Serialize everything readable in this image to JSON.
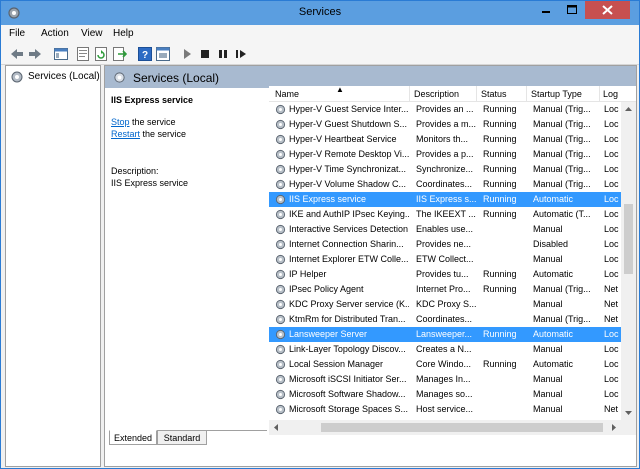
{
  "window": {
    "title": "Services"
  },
  "menu": [
    "File",
    "Action",
    "View",
    "Help"
  ],
  "toolbar": {
    "icons": [
      "back-arrow-icon",
      "forward-arrow-icon",
      "console-tree-icon",
      "refresh-icon",
      "export-list-icon",
      "help-icon",
      "properties-icon",
      "start-service-icon",
      "stop-service-icon",
      "pause-service-icon",
      "restart-service-icon"
    ]
  },
  "tree": {
    "label": "Services (Local)"
  },
  "pane": {
    "header_title": "Services (Local)",
    "selected_name": "IIS Express service",
    "stop_link": "Stop",
    "stop_rest": " the service",
    "restart_link": "Restart",
    "restart_rest": " the service",
    "desc_label": "Description:",
    "desc_text": "IIS Express service"
  },
  "columns": [
    "Name",
    "Description",
    "Status",
    "Startup Type",
    "Log"
  ],
  "rows": [
    {
      "name": "Hyper-V Guest Service Inter...",
      "desc": "Provides an ...",
      "status": "Running",
      "startup": "Manual (Trig...",
      "log": "Loc",
      "selected": false
    },
    {
      "name": "Hyper-V Guest Shutdown S...",
      "desc": "Provides a m...",
      "status": "Running",
      "startup": "Manual (Trig...",
      "log": "Loc",
      "selected": false
    },
    {
      "name": "Hyper-V Heartbeat Service",
      "desc": "Monitors th...",
      "status": "Running",
      "startup": "Manual (Trig...",
      "log": "Loc",
      "selected": false
    },
    {
      "name": "Hyper-V Remote Desktop Vi...",
      "desc": "Provides a p...",
      "status": "Running",
      "startup": "Manual (Trig...",
      "log": "Loc",
      "selected": false
    },
    {
      "name": "Hyper-V Time Synchronizat...",
      "desc": "Synchronize...",
      "status": "Running",
      "startup": "Manual (Trig...",
      "log": "Loc",
      "selected": false
    },
    {
      "name": "Hyper-V Volume Shadow C...",
      "desc": "Coordinates...",
      "status": "Running",
      "startup": "Manual (Trig...",
      "log": "Loc",
      "selected": false
    },
    {
      "name": "IIS Express service",
      "desc": "IIS Express s...",
      "status": "Running",
      "startup": "Automatic",
      "log": "Loc",
      "selected": true
    },
    {
      "name": "IKE and AuthIP IPsec Keying...",
      "desc": "The IKEEXT ...",
      "status": "Running",
      "startup": "Automatic (T...",
      "log": "Loc",
      "selected": false
    },
    {
      "name": "Interactive Services Detection",
      "desc": "Enables use...",
      "status": "",
      "startup": "Manual",
      "log": "Loc",
      "selected": false
    },
    {
      "name": "Internet Connection Sharin...",
      "desc": "Provides ne...",
      "status": "",
      "startup": "Disabled",
      "log": "Loc",
      "selected": false
    },
    {
      "name": "Internet Explorer ETW Colle...",
      "desc": "ETW Collect...",
      "status": "",
      "startup": "Manual",
      "log": "Loc",
      "selected": false
    },
    {
      "name": "IP Helper",
      "desc": "Provides tu...",
      "status": "Running",
      "startup": "Automatic",
      "log": "Loc",
      "selected": false
    },
    {
      "name": "IPsec Policy Agent",
      "desc": "Internet Pro...",
      "status": "Running",
      "startup": "Manual (Trig...",
      "log": "Net",
      "selected": false
    },
    {
      "name": "KDC Proxy Server service (K...",
      "desc": "KDC Proxy S...",
      "status": "",
      "startup": "Manual",
      "log": "Net",
      "selected": false
    },
    {
      "name": "KtmRm for Distributed Tran...",
      "desc": "Coordinates...",
      "status": "",
      "startup": "Manual (Trig...",
      "log": "Net",
      "selected": false
    },
    {
      "name": "Lansweeper Server",
      "desc": "Lansweeper...",
      "status": "Running",
      "startup": "Automatic",
      "log": "Loc",
      "selected": true
    },
    {
      "name": "Link-Layer Topology Discov...",
      "desc": "Creates a N...",
      "status": "",
      "startup": "Manual",
      "log": "Loc",
      "selected": false
    },
    {
      "name": "Local Session Manager",
      "desc": "Core Windo...",
      "status": "Running",
      "startup": "Automatic",
      "log": "Loc",
      "selected": false
    },
    {
      "name": "Microsoft iSCSI Initiator Ser...",
      "desc": "Manages In...",
      "status": "",
      "startup": "Manual",
      "log": "Loc",
      "selected": false
    },
    {
      "name": "Microsoft Software Shadow...",
      "desc": "Manages so...",
      "status": "",
      "startup": "Manual",
      "log": "Loc",
      "selected": false
    },
    {
      "name": "Microsoft Storage Spaces S...",
      "desc": "Host service...",
      "status": "",
      "startup": "Manual",
      "log": "Net",
      "selected": false
    }
  ],
  "tabs": {
    "extended": "Extended",
    "standard": "Standard"
  },
  "colors": {
    "selection": "#3399ff",
    "titlebar": "#5b9ee0",
    "close": "#c75050",
    "header": "#a8bad0"
  }
}
